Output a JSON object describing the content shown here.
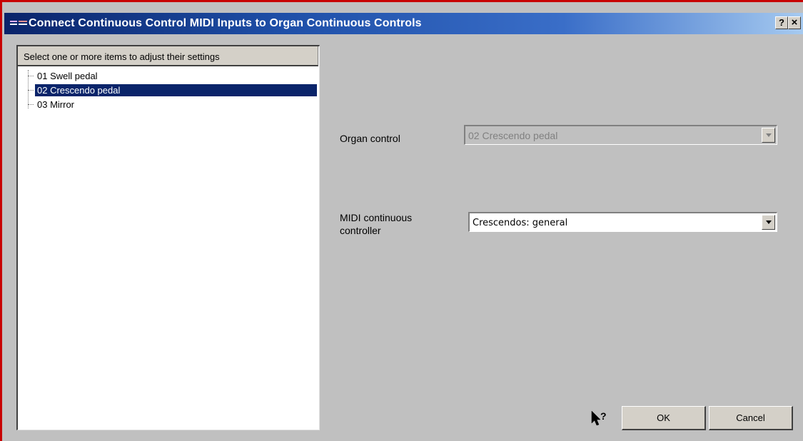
{
  "window": {
    "title": "Connect Continuous Control MIDI Inputs to Organ Continuous Controls",
    "help_button": "?",
    "close_button": "×"
  },
  "list": {
    "header": "Select one or more items to adjust their settings",
    "items": [
      {
        "label": "01 Swell pedal",
        "selected": false
      },
      {
        "label": "02 Crescendo pedal",
        "selected": true
      },
      {
        "label": "03 Mirror",
        "selected": false
      }
    ]
  },
  "form": {
    "organ_control": {
      "label": "Organ control",
      "value": "02 Crescendo pedal",
      "enabled": false
    },
    "midi_controller": {
      "label_line1": "MIDI continuous",
      "label_line2": "controller",
      "value": "Crescendos: general",
      "enabled": true
    }
  },
  "buttons": {
    "ok": "OK",
    "cancel": "Cancel"
  },
  "icons": {
    "window_icon": "organ-pipes-icon",
    "context_help": "context-help-cursor-icon"
  },
  "colors": {
    "titlebar_start": "#0a246a",
    "titlebar_end": "#a6caf0",
    "selection": "#0a246a",
    "dialog_bg": "#c0c0c0"
  }
}
